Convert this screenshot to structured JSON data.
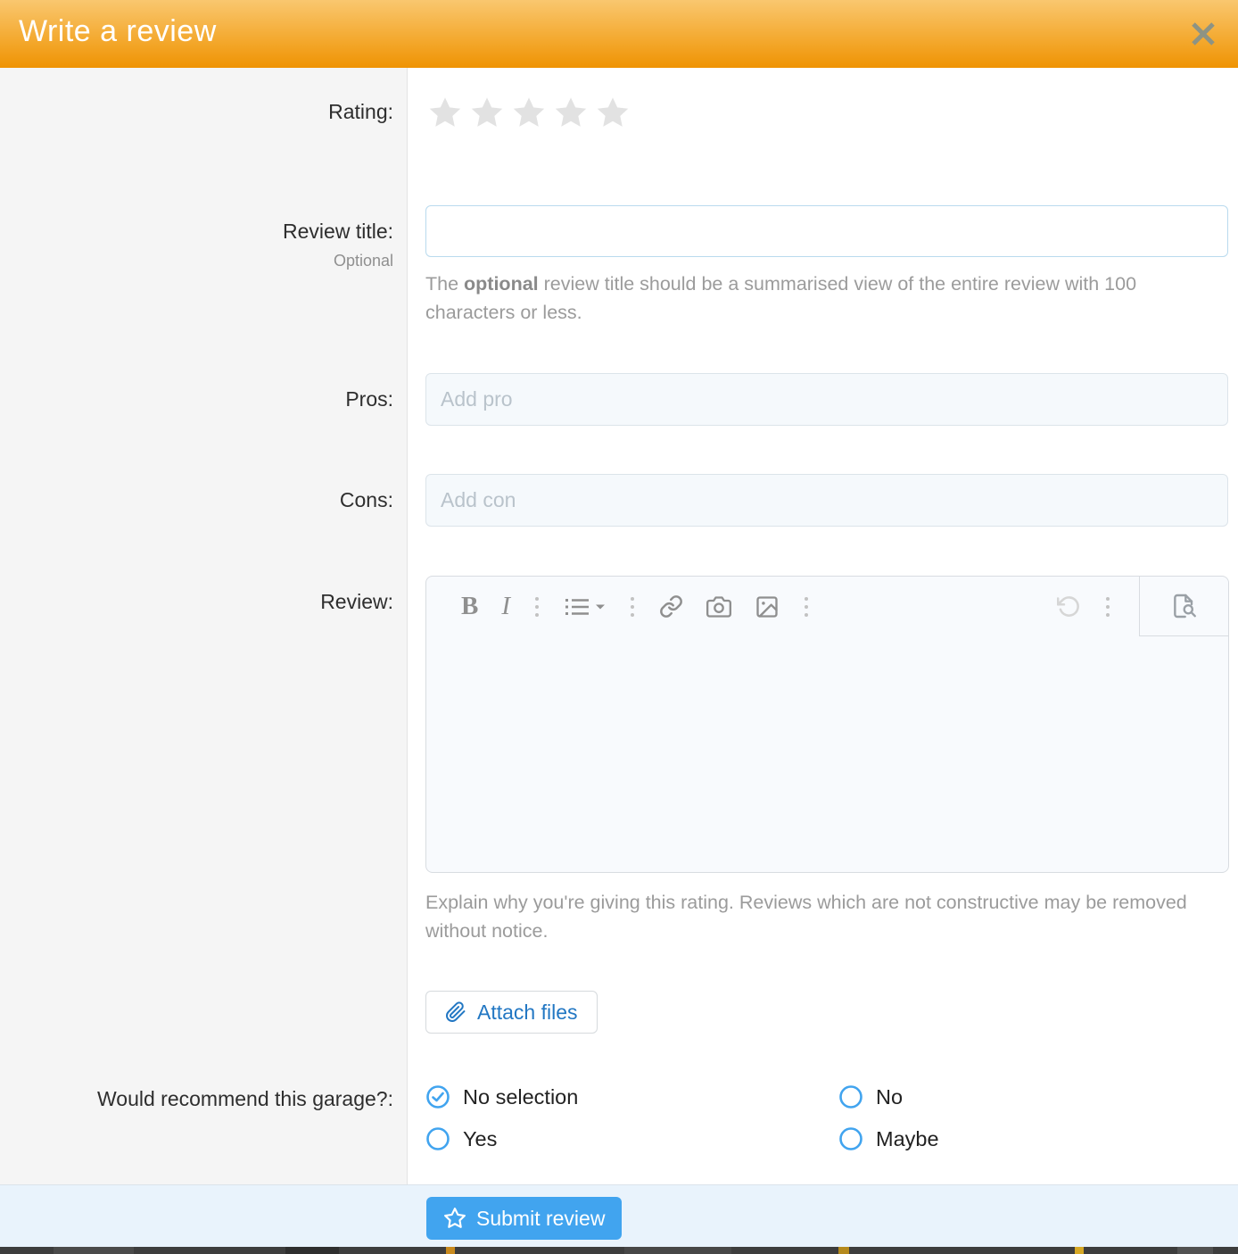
{
  "header": {
    "title": "Write a review"
  },
  "form": {
    "rating": {
      "label": "Rating:",
      "stars_total": 5,
      "stars_selected": 0
    },
    "review_title": {
      "label": "Review title:",
      "sublabel": "Optional",
      "value": "",
      "placeholder": "",
      "help_before": "The ",
      "help_bold": "optional",
      "help_after": " review title should be a summarised view of the entire review with 100 characters or less."
    },
    "pros": {
      "label": "Pros:",
      "placeholder": "Add pro",
      "value": ""
    },
    "cons": {
      "label": "Cons:",
      "placeholder": "Add con",
      "value": ""
    },
    "review": {
      "label": "Review:",
      "value": "",
      "help": "Explain why you're giving this rating. Reviews which are not constructive may be removed without notice.",
      "toolbar": {
        "bold_glyph": "B",
        "italic_glyph": "I",
        "icons": [
          "bold",
          "italic",
          "overflow-dots",
          "unordered-list",
          "overflow-dots",
          "link",
          "camera",
          "image",
          "overflow-dots",
          "undo",
          "overflow-dots",
          "document-preview"
        ]
      }
    },
    "attach_files": {
      "label": "Attach files"
    },
    "recommend": {
      "label": "Would recommend this garage?:",
      "options": [
        {
          "label": "No selection",
          "selected": true
        },
        {
          "label": "No",
          "selected": false
        },
        {
          "label": "Yes",
          "selected": false
        },
        {
          "label": "Maybe",
          "selected": false
        }
      ]
    }
  },
  "footer": {
    "submit_label": "Submit review"
  },
  "colors": {
    "header_gradient_top": "#f9c76f",
    "header_gradient_bottom": "#ef9303",
    "accent_blue": "#41a4ef",
    "link_blue": "#2277c3",
    "star_gray": "#e2e2e2",
    "toolbar_icon_gray": "#8f8f8f"
  }
}
